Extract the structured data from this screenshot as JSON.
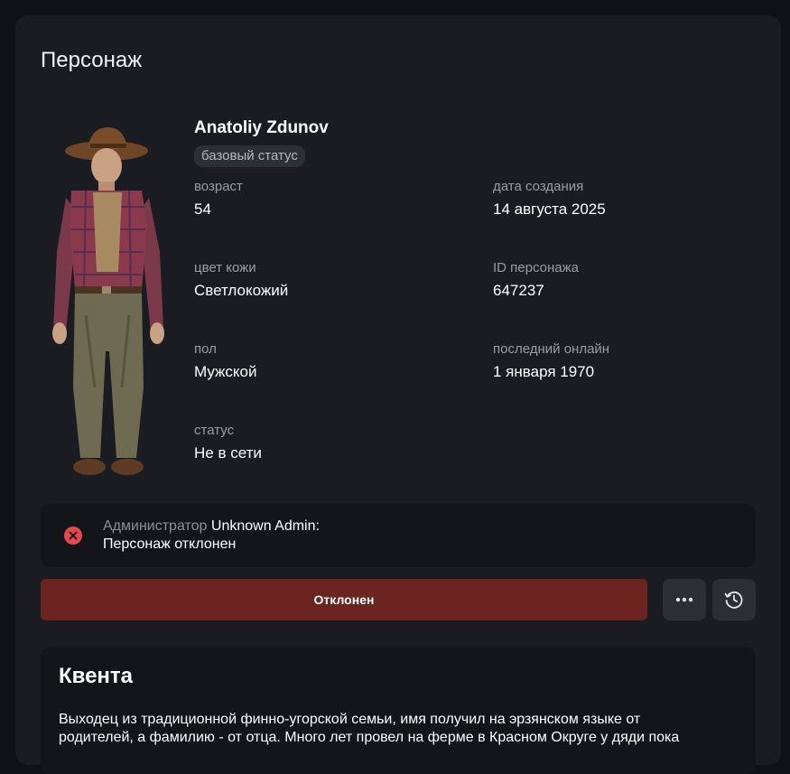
{
  "page": {
    "title": "Персонаж"
  },
  "character": {
    "name": "Anatoliy Zdunov",
    "badge": "базовый статус",
    "fields": {
      "age": {
        "label": "возраст",
        "value": "54"
      },
      "created": {
        "label": "дата создания",
        "value": "14 августа 2025"
      },
      "skin": {
        "label": "цвет кожи",
        "value": "Светлокожий"
      },
      "id": {
        "label": "ID персонажа",
        "value": "647237"
      },
      "sex": {
        "label": "пол",
        "value": "Мужской"
      },
      "last_online": {
        "label": "последний онлайн",
        "value": "1 января 1970"
      },
      "status": {
        "label": "статус",
        "value": "Не в сети"
      }
    }
  },
  "notice": {
    "role": "Администратор",
    "admin": "Unknown Admin:",
    "message": "Персонаж отклонен",
    "icon": "error-x-icon",
    "color": "#e5484d"
  },
  "actions": {
    "status_label": "Отклонен",
    "status_color": "#6b241f",
    "more_icon": "more-dots-icon",
    "history_icon": "history-clock-icon"
  },
  "lore": {
    "title": "Квента",
    "text": "Выходец из традиционной финно-угорской семьи, имя получил на эрзянском языке от родителей, а фамилию - от отца. Много лет провел на ферме в Красном Округе у дяди пока"
  }
}
